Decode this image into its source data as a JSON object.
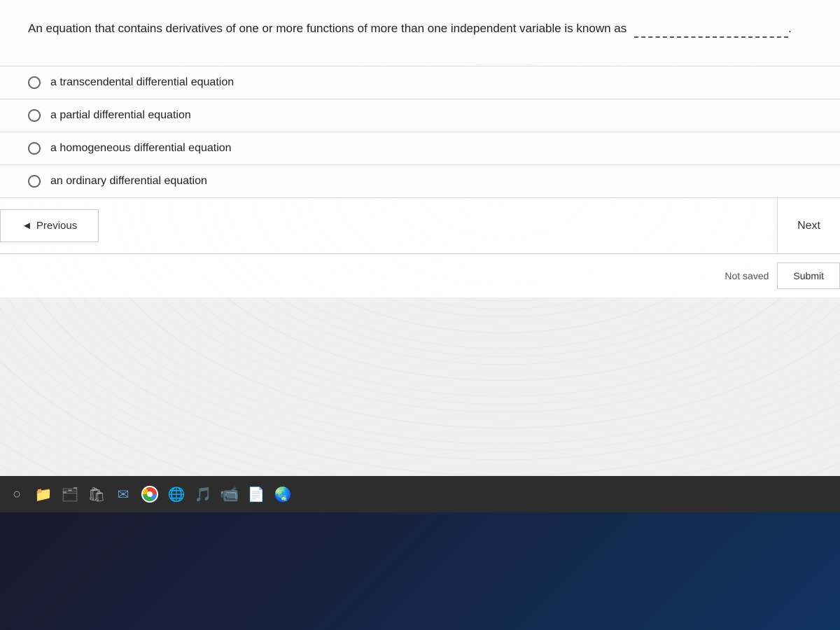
{
  "question": {
    "text_part1": "An equation that contains derivatives of one or more functions of more than one independent variable is known as",
    "blank_placeholder": "___________________________",
    "period": "."
  },
  "options": [
    {
      "id": "opt1",
      "label": "a transcendental differential equation"
    },
    {
      "id": "opt2",
      "label": "a partial differential equation"
    },
    {
      "id": "opt3",
      "label": "a homogeneous differential equation"
    },
    {
      "id": "opt4",
      "label": "an ordinary differential equation"
    }
  ],
  "navigation": {
    "previous_label": "Previous",
    "next_label": "Next",
    "previous_arrow": "◄"
  },
  "status": {
    "not_saved_label": "Not saved",
    "submit_label": "Submit"
  },
  "taskbar": {
    "icons": [
      "⊞",
      "⊟",
      "📁",
      "🗂",
      "✉",
      "⬤",
      "⬤",
      "⬤",
      "⬤",
      "⬤"
    ]
  }
}
